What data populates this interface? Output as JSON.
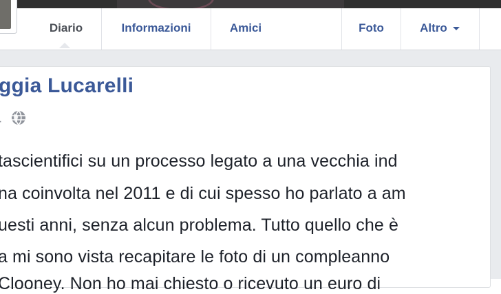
{
  "tabs": [
    {
      "label": "Diario",
      "active": true
    },
    {
      "label": "Informazioni",
      "active": false
    },
    {
      "label": "Amici",
      "active": false
    },
    {
      "label": "Foto",
      "active": false
    },
    {
      "label": "Altro",
      "active": false,
      "has_dropdown": true
    }
  ],
  "post": {
    "author": "ggia Lucarelli",
    "privacy_icon": "globe-icon",
    "lines": [
      "tascientifici su un processo legato a una vecchia ind",
      "na coinvolta nel 2011 e di cui spesso ho parlato a am",
      "uesti anni, senza alcun problema. Tutto quello che è",
      "a mi sono vista recapitare le foto di un compleanno",
      "Clooney. Non ho mai chiesto o ricevuto un euro di"
    ]
  },
  "colors": {
    "link_blue": "#3b5998",
    "text": "#1d2129",
    "muted": "#90949c",
    "background": "#e9ebee"
  }
}
